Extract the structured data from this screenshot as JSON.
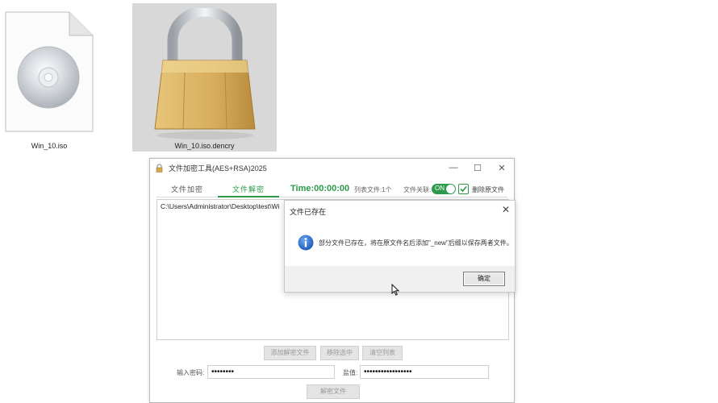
{
  "desktop": {
    "icons": [
      {
        "label": "Win_10.iso",
        "icon": "disc-file-icon"
      },
      {
        "label": "Win_10.iso.dencry",
        "icon": "padlock-icon"
      }
    ]
  },
  "window": {
    "title": "文件加密工具(AES+RSA)2025",
    "controls": {
      "minimize": "—",
      "maximize": "☐",
      "close": "✕"
    },
    "tabs": [
      {
        "label": "文件加密",
        "active": false
      },
      {
        "label": "文件解密",
        "active": true
      }
    ],
    "timer": "Time:00:00:00",
    "list_count": "列表文件:1个",
    "assoc_label": "文件关联:",
    "toggle_text": "ON",
    "delete_original_label": "删除原文件",
    "file_list": [
      "C:\\Users\\Administrator\\Desktop\\test\\Wi"
    ],
    "buttons": {
      "add": "添加解密文件",
      "remove": "移除选中",
      "clear": "清空列表",
      "decrypt": "解密文件"
    },
    "password_label": "输入密码:",
    "password_value": "••••••••",
    "salt_label": "盐值:",
    "salt_value": "•••••••••••••••••",
    "accent_color": "#2b9a4a"
  },
  "dialog": {
    "title": "文件已存在",
    "close": "✕",
    "message": "部分文件已存在，将在原文件名后添加\"_new\"后缀以保存两者文件。",
    "ok_label": "确定",
    "icon": "info-icon"
  }
}
